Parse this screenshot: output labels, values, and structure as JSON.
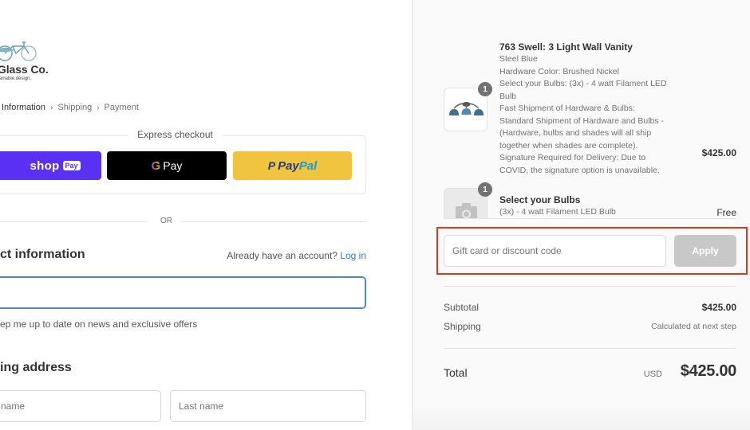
{
  "brand": {
    "name": "cle Glass Co.",
    "tagline": "dern.sustainable.design."
  },
  "breadcrumb": {
    "items": [
      "Information",
      "Shipping",
      "Payment"
    ],
    "separator": "›"
  },
  "express_checkout": {
    "title": "Express checkout",
    "shop_pay": {
      "word": "shop",
      "badge": "Pay"
    },
    "google_pay": {
      "g": "G",
      "word": "Pay"
    },
    "paypal": {
      "p": "P",
      "pay": "Pay",
      "pal": "Pal"
    },
    "colors": {
      "shop_pay": "#5a31f4",
      "google_pay": "#000000",
      "paypal": "#f0c43f"
    }
  },
  "or_label": "OR",
  "contact": {
    "title": "ct information",
    "account_prompt": "Already have an account?",
    "login_link": "Log in",
    "email_value": "",
    "newsletter_label": "ep me up to date on news and exclusive offers"
  },
  "shipping": {
    "title": "ing address",
    "first_name_placeholder": "name",
    "last_name_placeholder": "Last name"
  },
  "order": {
    "items": [
      {
        "quantity": "1",
        "title": "763 Swell: 3 Light Wall Vanity",
        "lines": [
          "Steel Blue",
          "Hardware Color: Brushed Nickel",
          "Select your Bulbs: (3x) - 4 watt Filament LED Bulb",
          "Fast Shipment of Hardware & Bulbs: Standard Shipment of Hardware and Bulbs - (Hardware, bulbs and shades will all ship together when shades are complete).",
          "Signature Required for Delivery: Due to COVID, the signature option is unavailable."
        ],
        "price": "$425.00"
      },
      {
        "quantity": "1",
        "title": "Select your Bulbs",
        "lines": [
          "(3x) - 4 watt Filament LED Bulb"
        ],
        "price": "Free"
      }
    ],
    "discount": {
      "placeholder": "Gift card or discount code",
      "value": "",
      "apply_label": "Apply",
      "highlight_color": "#d9391d"
    },
    "subtotal_label": "Subtotal",
    "subtotal_value": "$425.00",
    "shipping_label": "Shipping",
    "shipping_value": "Calculated at next step",
    "total_label": "Total",
    "total_currency": "USD",
    "total_value": "$425.00"
  }
}
